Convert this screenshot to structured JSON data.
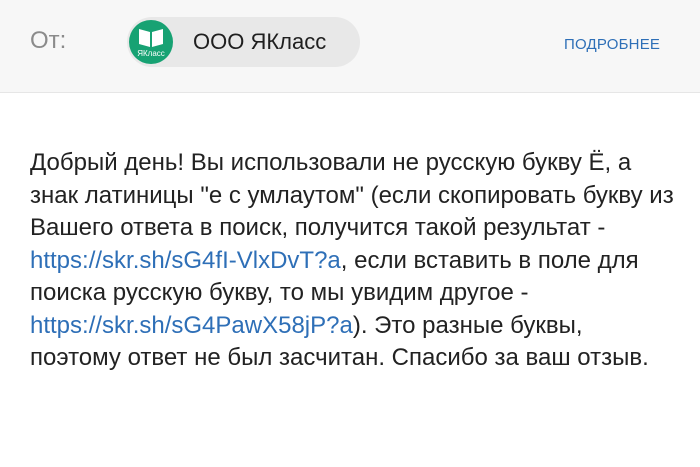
{
  "header": {
    "from_label": "От:",
    "sender_name": "ООО ЯКласс",
    "avatar_text": "ЯКласс",
    "more_label": "ПОДРОБНЕЕ"
  },
  "message": {
    "text_part1": "Добрый день! Вы использовали не русскую букву Ё, а знак латиницы \"е с умлаутом\" (если скопировать букву из Вашего ответа в поиск, получится такой результат - ",
    "link1": "https://skr.sh/sG4fI-VlxDvT?a",
    "text_part2": ", если вставить в поле для поиска русскую букву, то мы увидим другое - ",
    "link2": "https://skr.sh/sG4PawX58jP?a",
    "text_part3": "). Это разные буквы, поэтому ответ не был засчитан. Спасибо за ваш отзыв."
  },
  "colors": {
    "accent": "#2e6fb7",
    "avatar_bg": "#17a273",
    "header_bg": "#f7f7f7"
  },
  "icons": {
    "avatar": "book-icon"
  }
}
